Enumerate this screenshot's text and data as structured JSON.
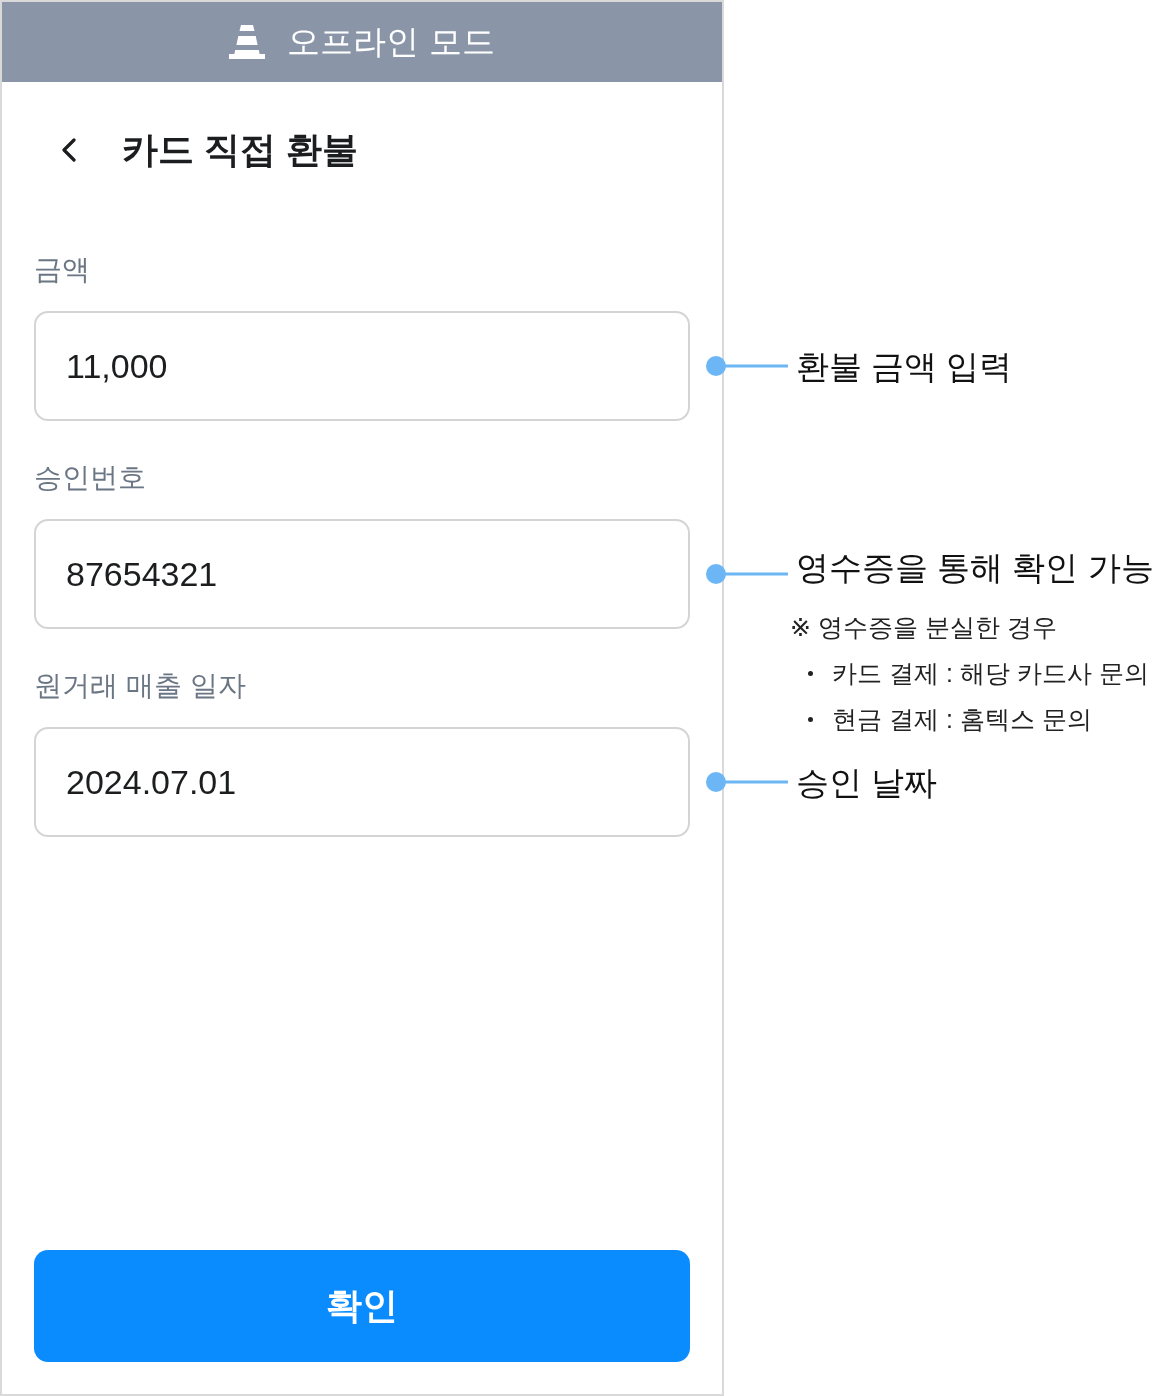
{
  "status_banner": {
    "text": "오프라인 모드"
  },
  "header": {
    "title": "카드 직접 환불"
  },
  "fields": [
    {
      "label": "금액",
      "value": "11,000",
      "annotation": {
        "title": "환불 금액 입력"
      }
    },
    {
      "label": "승인번호",
      "value": "87654321",
      "annotation": {
        "title": "영수증을 통해 확인 가능",
        "note": "※ 영수증을 분실한 경우",
        "bullets": [
          "카드 결제 : 해당 카드사 문의",
          "현금 결제 : 홈텍스 문의"
        ]
      }
    },
    {
      "label": "원거래 매출 일자",
      "value": "2024.07.01",
      "annotation": {
        "title": "승인 날짜"
      }
    }
  ],
  "confirm_button": {
    "label": "확인"
  }
}
